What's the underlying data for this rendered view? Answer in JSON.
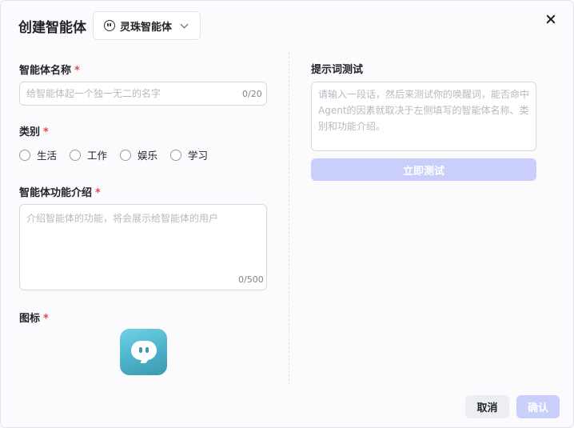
{
  "dialog": {
    "title": "创建智能体",
    "model_select": {
      "label": "灵珠智能体"
    }
  },
  "form": {
    "name": {
      "label": "智能体名称",
      "required_mark": "*",
      "placeholder": "给智能体起一个独一无二的名字",
      "counter": "0/20"
    },
    "category": {
      "label": "类别",
      "required_mark": "*",
      "options": [
        "生活",
        "工作",
        "娱乐",
        "学习"
      ]
    },
    "intro": {
      "label": "智能体功能介绍",
      "required_mark": "*",
      "placeholder": "介绍智能体的功能，将会展示给智能体的用户",
      "counter": "0/500"
    },
    "icon": {
      "label": "图标",
      "required_mark": "*"
    }
  },
  "prompt_test": {
    "label": "提示词测试",
    "placeholder": "请输入一段话，然后来测试你的唤醒词，能否命中Agent的因素就取决于左侧填写的智能体名称、类别和功能介绍。",
    "button": "立即测试"
  },
  "footer": {
    "cancel": "取消",
    "confirm": "确认"
  },
  "colors": {
    "primary_disabled": "#c9cefb",
    "required": "#e5484d",
    "icon_gradient_start": "#6fd3e6",
    "icon_gradient_end": "#3d98ae"
  }
}
